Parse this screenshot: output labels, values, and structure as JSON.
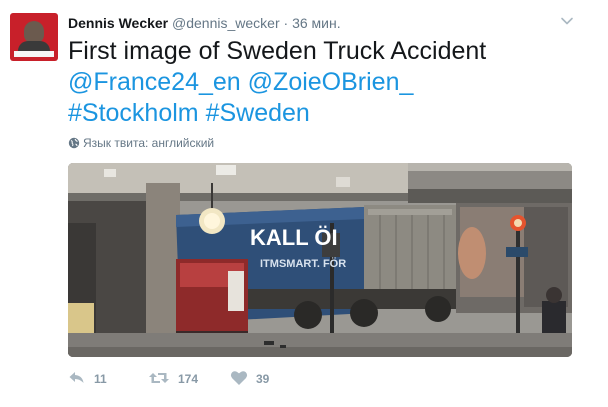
{
  "tweet": {
    "author_name": "Dennis Wecker",
    "author_handle": "@dennis_wecker",
    "separator": "·",
    "time": "36 мин.",
    "text_plain": "First image of Sweden Truck Accident",
    "mentions": [
      "@France24_en",
      "@ZoieOBrien_"
    ],
    "hashtags": [
      "#Stockholm",
      "#Sweden"
    ],
    "language_label": "Язык твита: английский",
    "media": {
      "truck_sign_top": "KALL ÖI",
      "truck_sign_bottom": "ITMSMART. FÖR"
    },
    "actions": {
      "reply_count": "11",
      "retweet_count": "174",
      "like_count": "39"
    }
  },
  "colors": {
    "link": "#1b95e0",
    "meta": "#657786",
    "action": "#8899a6",
    "avatar_bg": "#c8202a"
  },
  "icons": [
    "chevron-down-icon",
    "globe-icon",
    "reply-icon",
    "retweet-icon",
    "heart-icon"
  ]
}
